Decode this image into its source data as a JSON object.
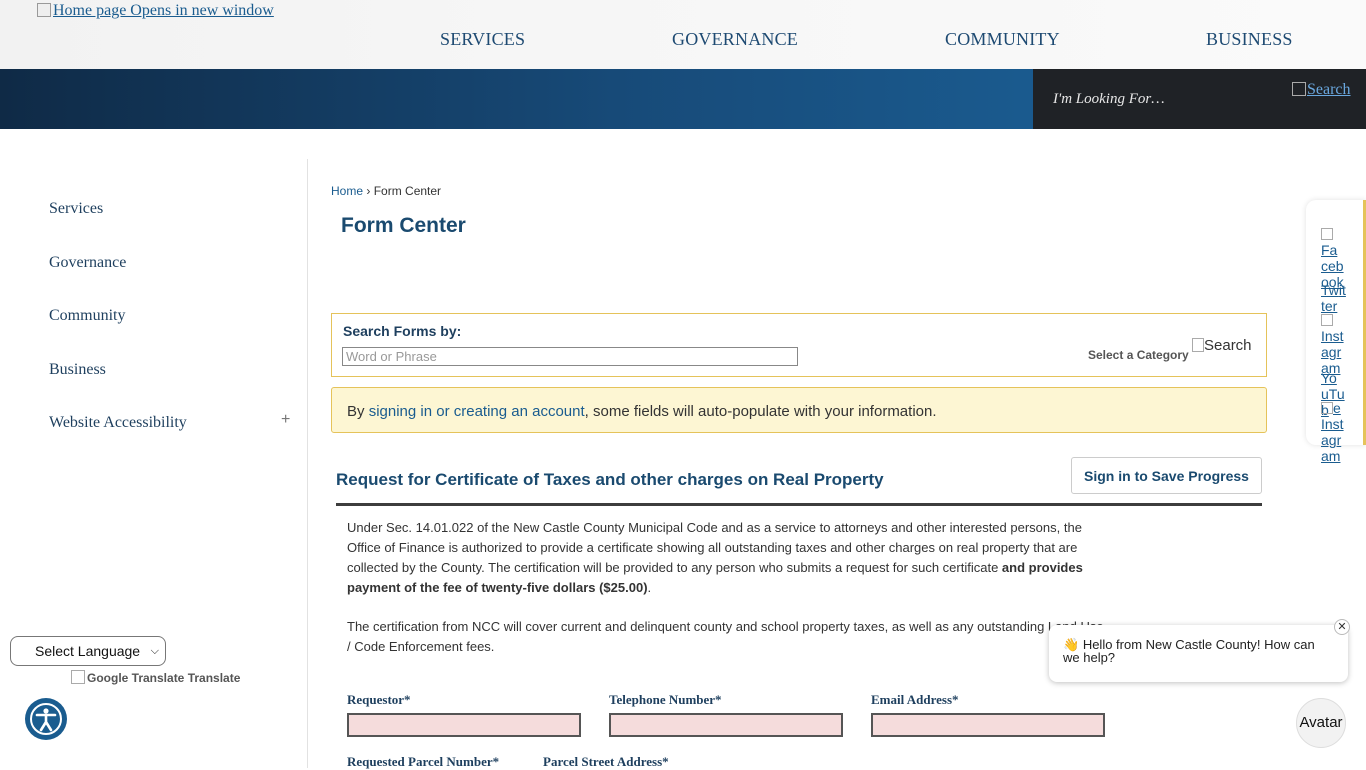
{
  "header": {
    "logo_alt": "Home page Opens in new window",
    "nav": [
      "SERVICES",
      "GOVERNANCE",
      "COMMUNITY",
      "BUSINESS"
    ],
    "search_placeholder": "I'm Looking For…",
    "search_button": "Search"
  },
  "sidebar": {
    "items": [
      "Services",
      "Governance",
      "Community",
      "Business",
      "Website Accessibility"
    ],
    "expand_symbol": "+",
    "language_select": "Select Language",
    "translate_alt": "Google Translate",
    "translate_label": "Translate"
  },
  "breadcrumb": {
    "home": "Home",
    "separator": "›",
    "current": "Form Center"
  },
  "page_title": "Form Center",
  "search_forms": {
    "label": "Search Forms by:",
    "placeholder": "Word or Phrase",
    "category": "Select a Category",
    "button": "Search"
  },
  "notice": {
    "prefix": "By ",
    "link": "signing in or creating an account",
    "suffix": ", some fields will auto-populate with your information."
  },
  "form": {
    "title": "Request for Certificate of Taxes and other charges on Real Property",
    "save_button": "Sign in to Save Progress",
    "para1_plain": "Under Sec. 14.01.022 of the New Castle County Municipal Code and as a service to attorneys and other interested persons, the Office of Finance is authorized to provide a certificate showing all outstanding taxes and other charges on real property that are collected by the County. The certification will be provided to any person who submits a request for such certificate ",
    "para1_bold": "and provides payment of the fee of twenty-five dollars ($25.00)",
    "para1_end": ".",
    "para2": "The certification from NCC will cover current and delinquent county and school property taxes, as well as any outstanding Land Use / Code Enforcement fees.",
    "fields": [
      "Requestor*",
      "Telephone Number*",
      "Email Address*",
      "Requested Parcel Number*",
      "Parcel Street Address*"
    ]
  },
  "social": [
    "Fa",
    "ceb",
    "ook",
    "Tw",
    "itter",
    "Inst",
    "agr",
    "am",
    "Yo",
    "uTub",
    "e",
    "Inst",
    "agr",
    "am"
  ],
  "chat": {
    "emoji": "👋",
    "message": "Hello from New Castle County! How can we help?",
    "close": "✕",
    "avatar": "Avatar"
  },
  "colors": {
    "brand_blue": "#1a5c8f",
    "accent_gold": "#e5c35a",
    "notice_bg": "#fdf6d3",
    "required_field_bg": "#f5dcdc"
  }
}
